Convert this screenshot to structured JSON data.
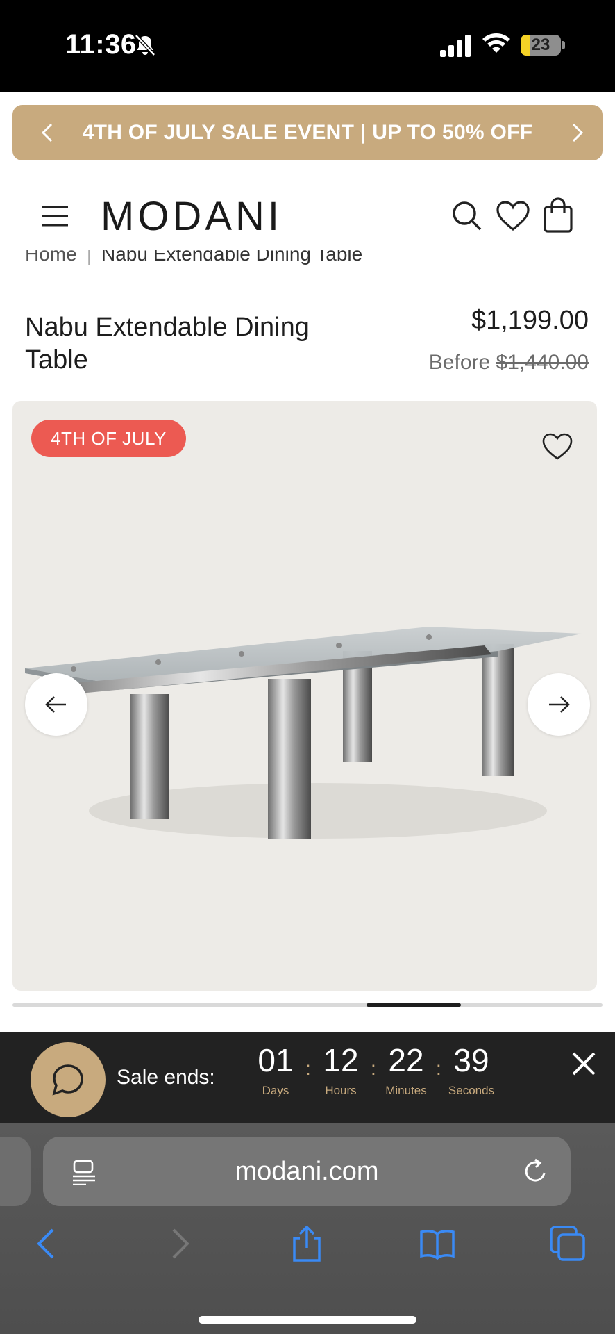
{
  "status_bar": {
    "time": "11:36",
    "battery_level": "23",
    "battery_fraction": 0.23
  },
  "promo": {
    "text": "4TH OF JULY SALE EVENT | UP TO 50% OFF",
    "color": "#c8aa7e"
  },
  "header": {
    "logo": "MODANI",
    "icons": [
      "menu-icon",
      "search-icon",
      "heart-icon",
      "bag-icon"
    ]
  },
  "breadcrumb": {
    "home": "Home",
    "separator": "|",
    "current": "Nabu Extendable Dining Table"
  },
  "product": {
    "title": "Nabu Extendable Dining Table",
    "price": "$1,199.00",
    "before_label": "Before",
    "before_price": "$1,440.00",
    "badge": "4TH OF JULY",
    "badge_color": "#ec5a52"
  },
  "gallery": {
    "progress_start": 0.6,
    "progress_end": 0.76
  },
  "countdown": {
    "label": "Sale ends:",
    "units": [
      {
        "value": "01",
        "label": "Days"
      },
      {
        "value": "12",
        "label": "Hours"
      },
      {
        "value": "22",
        "label": "Minutes"
      },
      {
        "value": "39",
        "label": "Seconds"
      }
    ],
    "separator": ":",
    "accent": "#c8aa7e"
  },
  "browser": {
    "url": "modani.com",
    "toolbar_icons": [
      "back-icon",
      "forward-icon",
      "share-icon",
      "bookmarks-icon",
      "tabs-icon"
    ],
    "icon_color": "#3a8af5"
  }
}
